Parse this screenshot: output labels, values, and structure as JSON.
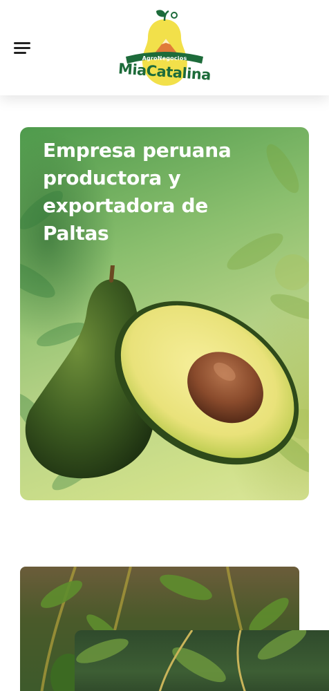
{
  "header": {
    "menu_icon": "hamburger-menu-icon",
    "logo": {
      "subtitle": "AgroNegocios",
      "name": "MiaCatalina"
    }
  },
  "hero": {
    "title": "Empresa peruana productora y exportadora de Paltas"
  },
  "colors": {
    "brand_green": "#1d6b3a",
    "logo_yellow": "#f2e04a",
    "hero_text": "#ffffff"
  }
}
